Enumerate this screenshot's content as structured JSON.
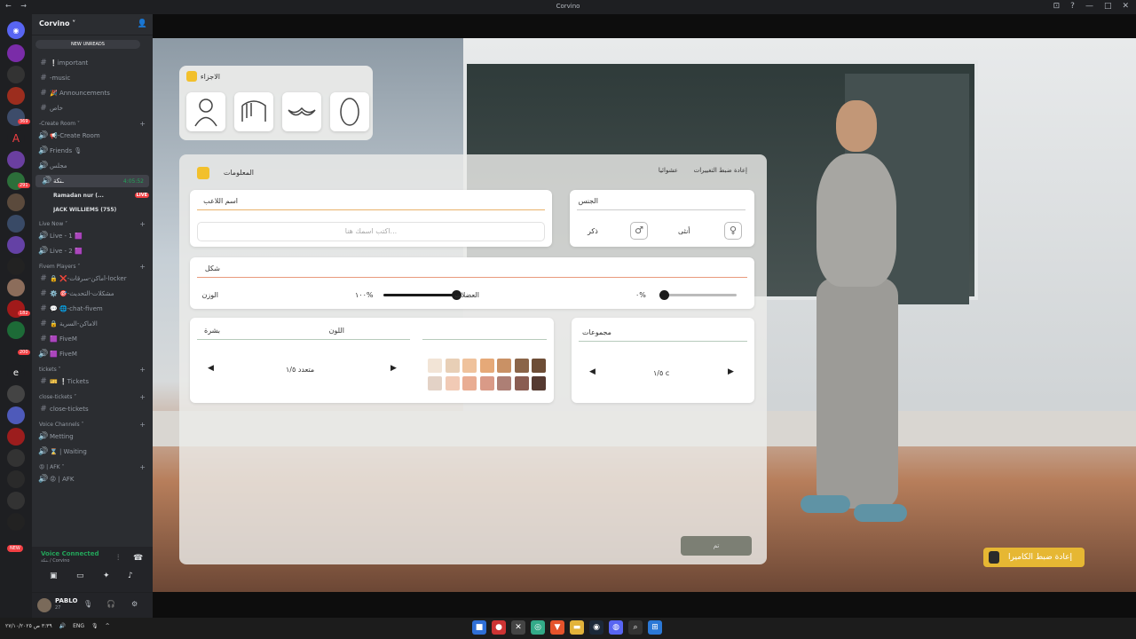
{
  "window": {
    "title": "Corvino",
    "nav": "← →",
    "controls": [
      "⊡",
      "?",
      "—",
      "□",
      "✕"
    ]
  },
  "servers": {
    "badges": [
      "369",
      "291",
      "182",
      "200"
    ],
    "new_label": "NEW",
    "letters": [
      "A",
      "e"
    ]
  },
  "server": {
    "name": "Corvino ˅",
    "new_unreads": "NEW UNREADS"
  },
  "channels": [
    {
      "kind": "channel",
      "label": "❕important",
      "icon": "#"
    },
    {
      "kind": "channel",
      "label": "-music",
      "icon": "#"
    },
    {
      "kind": "channel",
      "label": "🎉 Announcements",
      "icon": "#"
    },
    {
      "kind": "channel",
      "label": "خاص",
      "icon": "#"
    },
    {
      "kind": "category",
      "label": "-Create Room ˅"
    },
    {
      "kind": "channel",
      "label": "📢-Create Room",
      "icon": "🔊"
    },
    {
      "kind": "channel",
      "label": "Friends 🎙",
      "icon": "🔊"
    },
    {
      "kind": "channel",
      "label": "مجلس",
      "icon": "🔊"
    },
    {
      "kind": "active",
      "label": "ـنكة",
      "icon": "🔊",
      "time": "4:05:52"
    },
    {
      "kind": "user",
      "label": "Ramadan nur (...",
      "live": "LIVE"
    },
    {
      "kind": "user",
      "label": "JACK WILLIEMS (755)"
    },
    {
      "kind": "category",
      "label": "Live Now ˅"
    },
    {
      "kind": "channel",
      "label": "Live - 1 🟪",
      "icon": "🔊"
    },
    {
      "kind": "channel",
      "label": "Live - 2 🟪",
      "icon": "🔊"
    },
    {
      "kind": "category",
      "label": "Fivem Players ˅"
    },
    {
      "kind": "channel",
      "label": "🔒 ❌-أماكن-سرقات-locker",
      "icon": "#"
    },
    {
      "kind": "channel",
      "label": "⚙️ 🎯-مشكلات-التحديث",
      "icon": "#"
    },
    {
      "kind": "channel",
      "label": "💬 🌐-chat-fivem",
      "icon": "#"
    },
    {
      "kind": "channel",
      "label": "🔒 الاماكن-السرية",
      "icon": "#"
    },
    {
      "kind": "channel",
      "label": "🟪 FiveM",
      "icon": "#"
    },
    {
      "kind": "channel",
      "label": "🟪 FiveM",
      "icon": "🔊"
    },
    {
      "kind": "category",
      "label": "tickets ˅"
    },
    {
      "kind": "channel",
      "label": "🎫 ❕Tickets",
      "icon": "#"
    },
    {
      "kind": "category",
      "label": "close-tickets ˅"
    },
    {
      "kind": "channel",
      "label": "close-tickets",
      "icon": "#"
    },
    {
      "kind": "category",
      "label": "Voice Channels ˅"
    },
    {
      "kind": "channel",
      "label": "Metting",
      "icon": "🔊"
    },
    {
      "kind": "channel",
      "label": "⌛ | Waiting",
      "icon": "🔊"
    },
    {
      "kind": "category",
      "label": "😡 | AFK ˅"
    },
    {
      "kind": "channel",
      "label": "😡 | AFK",
      "icon": "🔊"
    }
  ],
  "voice": {
    "status": "Voice Connected",
    "location": "ـنكة / Corvino"
  },
  "user": {
    "name": "PABLO",
    "status": "27"
  },
  "ui_parts": {
    "title": "الاجزاء"
  },
  "ui_main": {
    "title": "المعلومات",
    "reset": "إعادة ضبط التغييرات",
    "random": "عشوائيا",
    "player_name_label": "اسم اللاعب",
    "player_name_placeholder": "اكتب اسمك هنا...",
    "gender_label": "الجنس",
    "female": "أنثى",
    "male": "ذكر",
    "shape_label": "شكل",
    "weight_label": "الوزن",
    "weight_value": "١٠٠%",
    "muscle_label": "العضلات",
    "muscle_value": "٠%",
    "skin_label": "بشرة",
    "skin_value": "متعدد ١/٥",
    "color_label": "اللون",
    "groups_label": "مجموعات",
    "groups_value": "١/٥ c",
    "confirm": "تم"
  },
  "camera_reset": "إعادة ضبط الكاميرا",
  "taskbar": {
    "time": "٣:٣٩ ص",
    "date": "٢٧/١٠/٢٠٢٥",
    "lang": "ENG"
  },
  "colors": {
    "accent": "#f2c02c",
    "weight_slider": 1.0,
    "muscle_slider": 0.0,
    "swatches_top": [
      "#f2e4d6",
      "#e8cfb6",
      "#efc29c",
      "#e6a978",
      "#c99165",
      "#8a6448",
      "#6d4d36"
    ],
    "swatches_bottom": [
      "#e3d2c6",
      "#f1cab5",
      "#e9ad93",
      "#d99a87",
      "#ad7f75",
      "#8a5d52",
      "#553a31"
    ]
  }
}
